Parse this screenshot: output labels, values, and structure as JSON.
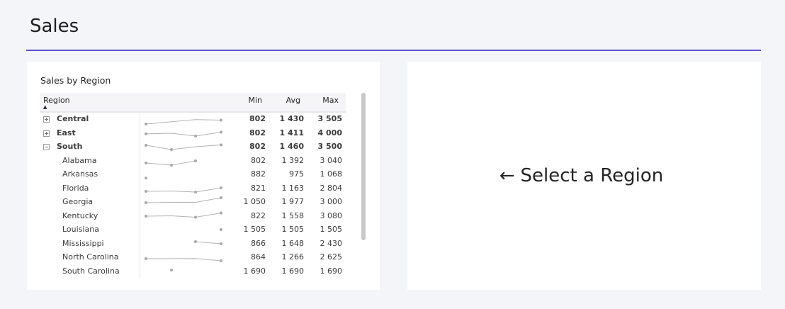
{
  "page": {
    "title": "Sales",
    "accent_color": "#5b4fd6"
  },
  "table_visual": {
    "title": "Sales by Region",
    "columns": {
      "region": "Region",
      "min": "Min",
      "avg": "Avg",
      "max": "Max"
    },
    "sort": {
      "column": "Region",
      "direction": "ascending"
    },
    "rows": [
      {
        "label": "Central",
        "level": 0,
        "expander": "plus",
        "min": "802",
        "avg": "1 430",
        "max": "3 505",
        "trend": [
          802,
          1430,
          1350
        ]
      },
      {
        "label": "East",
        "level": 0,
        "expander": "plus",
        "min": "802",
        "avg": "1 411",
        "max": "4 000",
        "trend": [
          1411,
          1500,
          1100,
          1650
        ]
      },
      {
        "label": "South",
        "level": 0,
        "expander": "minus",
        "min": "802",
        "avg": "1 460",
        "max": "3 500",
        "trend": [
          1700,
          1100,
          1500,
          1750
        ]
      },
      {
        "label": "Alabama",
        "level": 1,
        "min": "802",
        "avg": "1 392",
        "max": "3 040",
        "trend": [
          1200,
          900,
          1500
        ]
      },
      {
        "label": "Arkansas",
        "level": 1,
        "min": "882",
        "avg": "975",
        "max": "1 068",
        "trend": [
          975
        ]
      },
      {
        "label": "Florida",
        "level": 1,
        "min": "821",
        "avg": "1 163",
        "max": "2 804",
        "trend": [
          1100,
          1150,
          1000,
          1600
        ]
      },
      {
        "label": "Georgia",
        "level": 1,
        "min": "1 050",
        "avg": "1 977",
        "max": "3 000",
        "trend": [
          1400,
          1450,
          1450,
          2100
        ]
      },
      {
        "label": "Kentucky",
        "level": 1,
        "min": "822",
        "avg": "1 558",
        "max": "3 080",
        "trend": [
          1500,
          1550,
          1350,
          1950
        ]
      },
      {
        "label": "Louisiana",
        "level": 1,
        "min": "1 505",
        "avg": "1 505",
        "max": "1 505",
        "trend": [
          1505
        ]
      },
      {
        "label": "Mississippi",
        "level": 1,
        "min": "866",
        "avg": "1 648",
        "max": "2 430",
        "trend": [
          1800,
          1500
        ]
      },
      {
        "label": "North Carolina",
        "level": 1,
        "min": "864",
        "avg": "1 266",
        "max": "2 625",
        "trend": [
          1300,
          1320,
          1000
        ]
      },
      {
        "label": "South Carolina",
        "level": 1,
        "min": "1 690",
        "avg": "1 690",
        "max": "1 690",
        "trend": [
          1690
        ]
      }
    ]
  },
  "detail_visual": {
    "arrow": "←",
    "text": "Select a Region"
  }
}
